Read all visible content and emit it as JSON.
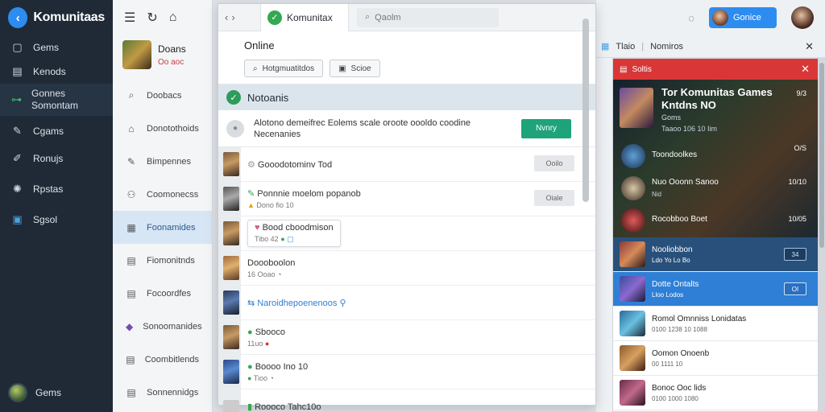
{
  "nav": {
    "brand": "Komunitaas",
    "items": [
      {
        "icon": "square-icon",
        "label": "Gems"
      },
      {
        "icon": "file-icon",
        "label": "Kenods"
      },
      {
        "icon": "controller-icon",
        "label": "Gonnes Somontam"
      },
      {
        "icon": "pencil-icon",
        "label": "Cgams"
      },
      {
        "icon": "edit-icon",
        "label": "Ronujs"
      },
      {
        "icon": "globe-icon",
        "label": "Rpstas"
      },
      {
        "icon": "box-icon",
        "label": "Sgsol"
      }
    ],
    "footer_label": "Gems"
  },
  "mid": {
    "profile_name": "Doans",
    "profile_status": "Oo aoc",
    "rows": [
      {
        "icon": "search-icon",
        "label": "Doobacs"
      },
      {
        "icon": "home-icon",
        "label": "Donotothoids"
      },
      {
        "icon": "edit-icon",
        "label": "Bimpennes"
      },
      {
        "icon": "users-icon",
        "label": "Coomonecss"
      },
      {
        "icon": "grid-icon",
        "label": "Foonamides"
      },
      {
        "icon": "doc-icon",
        "label": "Fiomonitnds"
      },
      {
        "icon": "doc-icon",
        "label": "Focoordfes"
      },
      {
        "icon": "game-icon",
        "label": "Sonoomanides"
      },
      {
        "icon": "doc-icon",
        "label": "Coombitlends"
      },
      {
        "icon": "doc-icon",
        "label": "Sonnennidgs"
      }
    ]
  },
  "main": {
    "tab_label": "Komunitax",
    "search_placeholder": "Qaolm",
    "online_heading": "Online",
    "btn_primary": "Hotgmuatitdos",
    "btn_secondary": "Scioe",
    "notices_label": "Notoanis",
    "alert_text": "Alotono demeifrec Eolems scale oroote oooldo coodine Necenanies",
    "alert_button": "Nvnry",
    "feed": [
      {
        "title": "Gooodotominv Tod",
        "meta": "",
        "action": "Ooilo"
      },
      {
        "title": "Ponnnie moelom popanob",
        "meta": "Dono fio 10",
        "action": "Oiale"
      },
      {
        "title": "Bood cboodmison",
        "meta": "Tibo 42",
        "action": ""
      },
      {
        "title": "Doooboolon",
        "meta": "16 Ooao",
        "action": ""
      },
      {
        "title": "Naroidhepoenenoos",
        "meta": "",
        "action": ""
      },
      {
        "title": "Sbooco",
        "meta": "11uo",
        "action": ""
      },
      {
        "title": "Boooo Ino 10",
        "meta": "Tioo",
        "action": ""
      },
      {
        "title": "Roooco Tahc10o",
        "meta": "",
        "action": ""
      }
    ]
  },
  "right": {
    "user_label": "Gonice",
    "bar_left": "Tlaio",
    "bar_right": "Nomiros"
  },
  "game_panel": {
    "head_label": "Soltis",
    "title": "Tor Komunitas Games Kntdns NO",
    "subtitle": "Goms",
    "stat": "Taaoo 106 10 Iim",
    "count_top": "9/3",
    "banner_rows": [
      {
        "label": "Toondoolkes",
        "sub": "",
        "num": "O/S"
      },
      {
        "label": "Nuo Ooonn Sanoo",
        "sub": "Nid",
        "num": "10/10"
      },
      {
        "label": "Rocobboo Boet",
        "sub": "",
        "num": "10/05"
      }
    ],
    "list": [
      {
        "name": "Nooliobbon",
        "meta": "Ldo Yo Lo Bo",
        "btn": "34",
        "style": "dark"
      },
      {
        "name": "Dotte Ontalts",
        "meta": "Lloo Lodos",
        "btn": "OI",
        "style": "blue"
      },
      {
        "name": "Romol Omnniss Lonidatas",
        "meta": "0100 1238 10 1088",
        "btn": "",
        "style": "plain"
      },
      {
        "name": "Oomon Onoenb",
        "meta": "00 1111 10",
        "btn": "",
        "style": "plain"
      },
      {
        "name": "Bonoc Ooc lids",
        "meta": "0100 1000 1080",
        "btn": "",
        "style": "plain"
      }
    ]
  },
  "colors": {
    "nav_bg": "#1f2a36",
    "accent_blue": "#2d8cf0",
    "accent_green": "#1fa37a",
    "panel_red": "#d93737"
  }
}
